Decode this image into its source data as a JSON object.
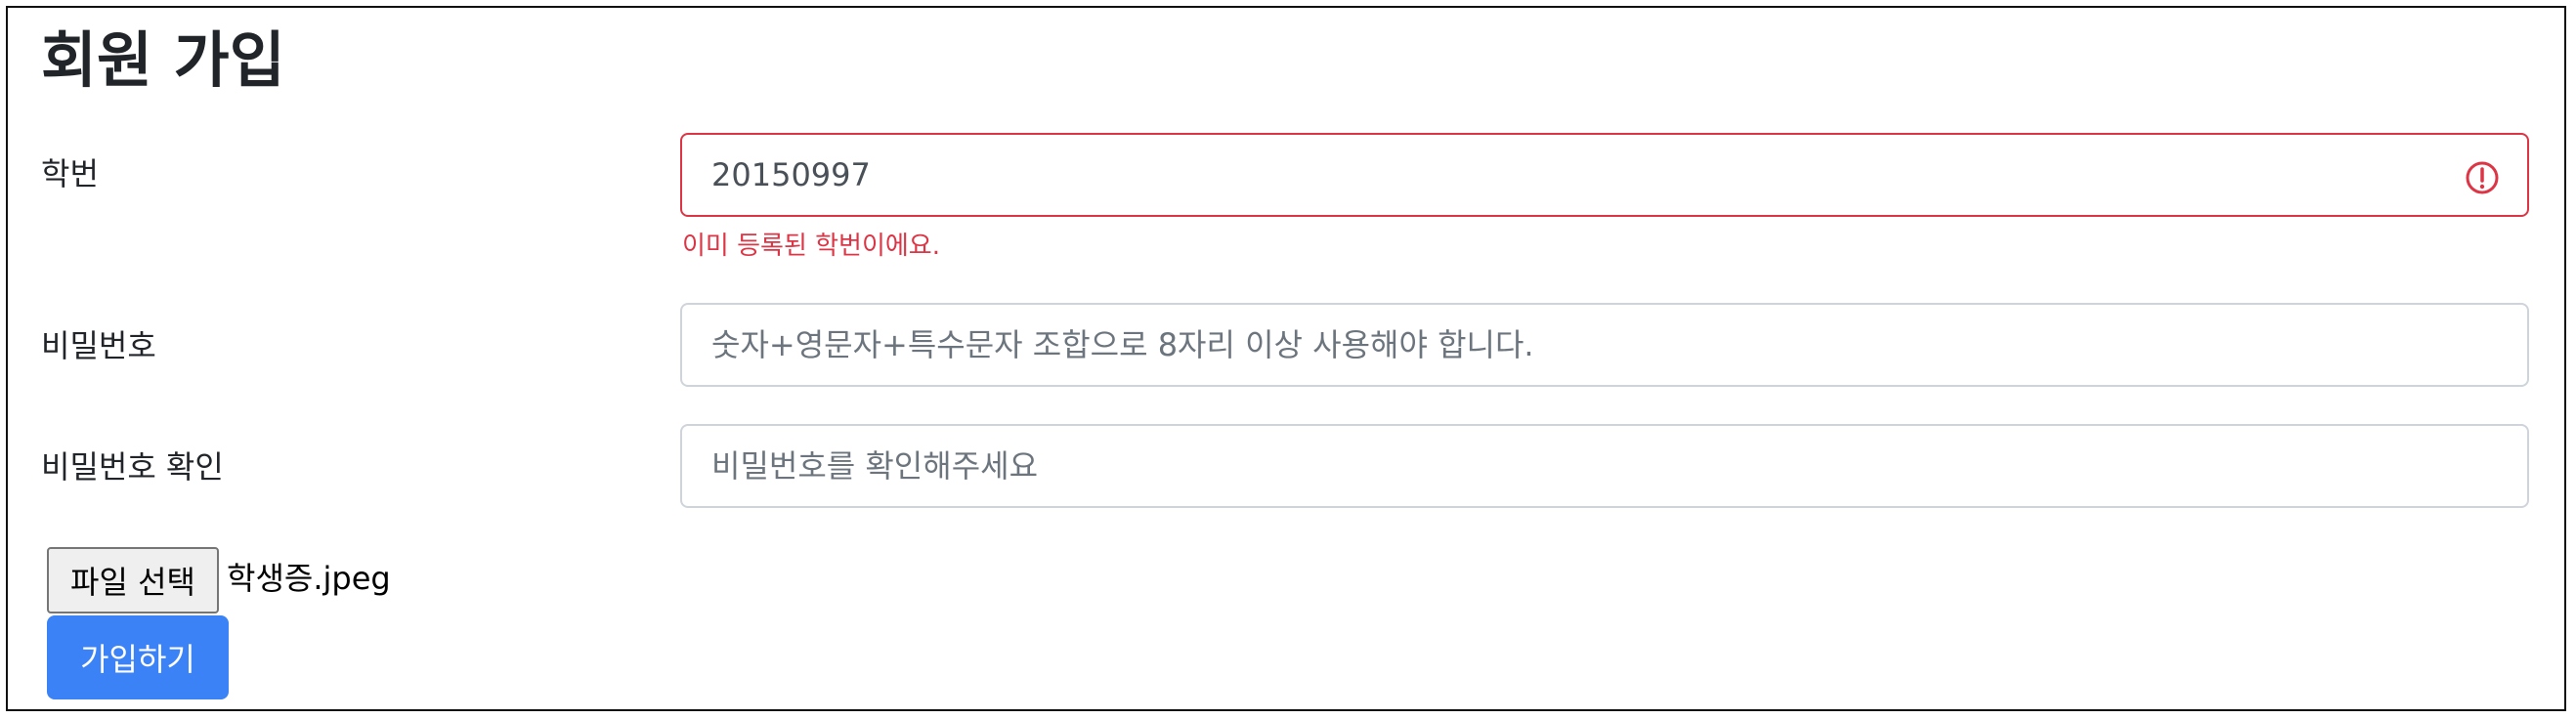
{
  "page": {
    "title": "회원 가입"
  },
  "form": {
    "student_id": {
      "label": "학번",
      "value": "20150997",
      "error": "이미 등록된 학번이에요."
    },
    "password": {
      "label": "비밀번호",
      "placeholder": "숫자+영문자+특수문자 조합으로 8자리 이상 사용해야 합니다."
    },
    "password_confirm": {
      "label": "비밀번호 확인",
      "placeholder": "비밀번호를 확인해주세요"
    },
    "file": {
      "button_label": "파일 선택",
      "file_name": "학생증.jpeg"
    },
    "submit_label": "가입하기"
  },
  "colors": {
    "error": "#dc3545",
    "primary": "#3b82f6",
    "input_border": "#ced4da"
  },
  "icons": {
    "invalid": "exclamation-circle-icon"
  }
}
